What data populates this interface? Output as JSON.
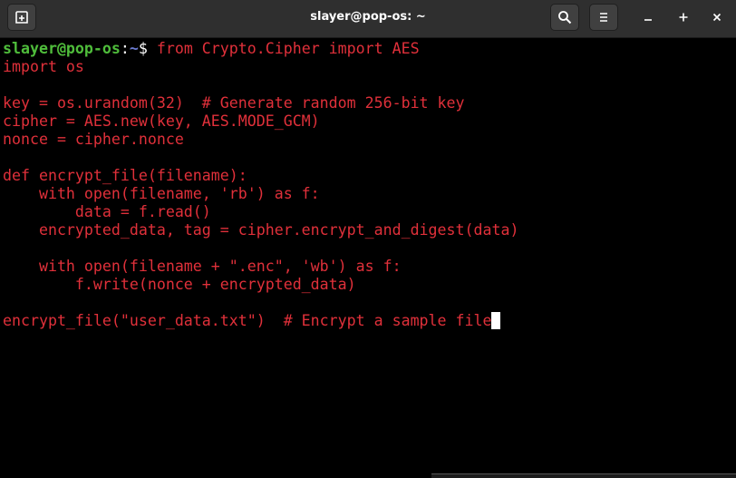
{
  "window": {
    "title": "slayer@pop-os: ~"
  },
  "titlebar": {
    "new_tab_icon": "new-tab-icon",
    "search_icon": "search-icon",
    "menu_icon": "hamburger-menu-icon",
    "minimize_icon": "minimize-icon",
    "maximize_icon": "maximize-icon",
    "close_icon": "close-icon"
  },
  "colors": {
    "background": "#000000",
    "titlebar": "#2f2f2f",
    "code_text": "#e0303a",
    "prompt_user": "#4fbd3b",
    "prompt_path": "#6b7bd0"
  },
  "terminal": {
    "prompt": {
      "user_host": "slayer@pop-os",
      "separator": ":",
      "path": "~",
      "symbol": "$ "
    },
    "command": "from Crypto.Cipher import AES",
    "lines": [
      "import os",
      "",
      "key = os.urandom(32)  # Generate random 256-bit key",
      "cipher = AES.new(key, AES.MODE_GCM)",
      "nonce = cipher.nonce",
      "",
      "def encrypt_file(filename):",
      "    with open(filename, 'rb') as f:",
      "        data = f.read()",
      "    encrypted_data, tag = cipher.encrypt_and_digest(data)",
      "",
      "    with open(filename + \".enc\", 'wb') as f:",
      "        f.write(nonce + encrypted_data)",
      "",
      "encrypt_file(\"user_data.txt\")  # Encrypt a sample file"
    ]
  }
}
